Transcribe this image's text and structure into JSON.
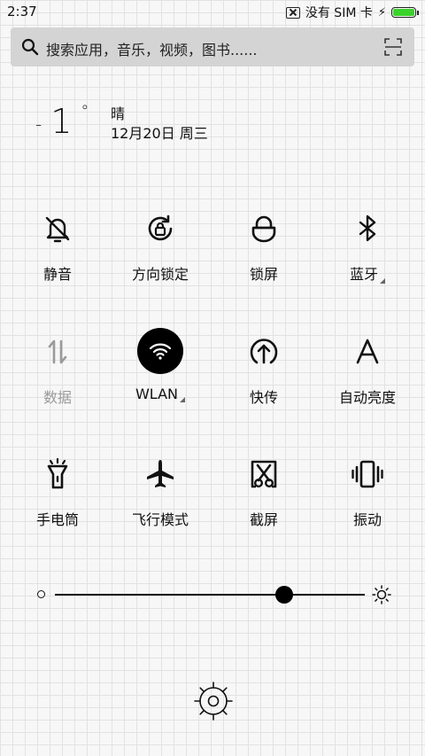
{
  "status_bar": {
    "time": "2:37",
    "carrier": "没有 SIM 卡",
    "battery_color": "#3bd22b"
  },
  "search": {
    "placeholder": "搜索应用，音乐，视频，图书......"
  },
  "weather": {
    "temperature": "-1°",
    "temp_minus": "-",
    "temp_value": "1",
    "temp_degree": "°",
    "condition": "晴",
    "date": "12月20日 周三"
  },
  "toggles": [
    {
      "label": "静音",
      "icon": "bell-off-icon",
      "active": false
    },
    {
      "label": "方向锁定",
      "icon": "rotation-lock-icon",
      "active": false
    },
    {
      "label": "锁屏",
      "icon": "lock-icon",
      "active": false
    },
    {
      "label": "蓝牙",
      "icon": "bluetooth-icon",
      "active": false
    },
    {
      "label": "数据",
      "icon": "mobile-data-icon",
      "active": false
    },
    {
      "label": "WLAN",
      "icon": "wifi-icon",
      "active": true
    },
    {
      "label": "快传",
      "icon": "share-upload-icon",
      "active": false
    },
    {
      "label": "自动亮度",
      "icon": "auto-brightness-icon",
      "active": false
    },
    {
      "label": "手电筒",
      "icon": "flashlight-icon",
      "active": false
    },
    {
      "label": "飞行模式",
      "icon": "airplane-icon",
      "active": false
    },
    {
      "label": "截屏",
      "icon": "screenshot-icon",
      "active": false
    },
    {
      "label": "振动",
      "icon": "vibrate-icon",
      "active": false
    }
  ],
  "brightness": {
    "level": 0.74
  }
}
